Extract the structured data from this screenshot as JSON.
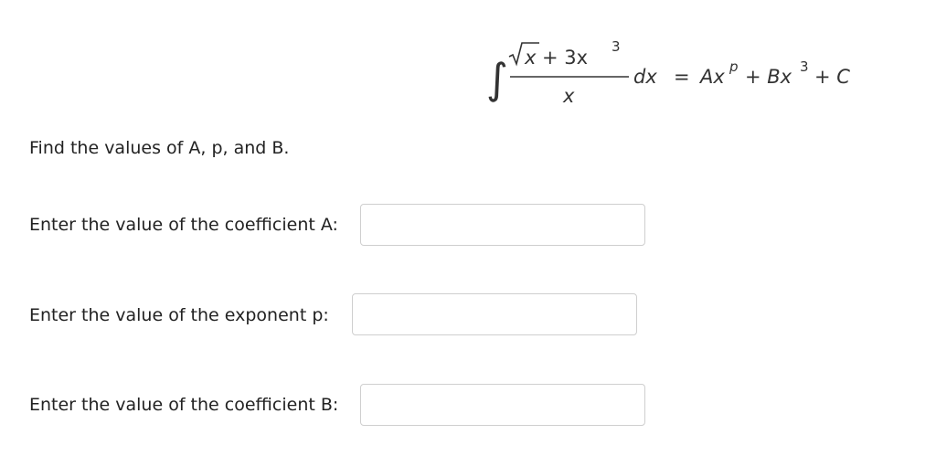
{
  "equation": {
    "integral_sign": "∫",
    "numerator_sqrt_var": "x",
    "numerator_rest": "+ 3x",
    "numerator_exp": "3",
    "denominator": "x",
    "differential": "dx",
    "equals": "=",
    "rhs_A": "Ax",
    "rhs_p": "p",
    "rhs_plus_B": "+ Bx",
    "rhs_exp3": "3",
    "rhs_plus_C": "+ C"
  },
  "prompt": "Find the values of A, p, and B.",
  "fields": [
    {
      "label": "Enter the value of the coefficient A:",
      "value": ""
    },
    {
      "label": "Enter the value of the exponent p:",
      "value": ""
    },
    {
      "label": "Enter the value of the coefficient B:",
      "value": ""
    }
  ]
}
